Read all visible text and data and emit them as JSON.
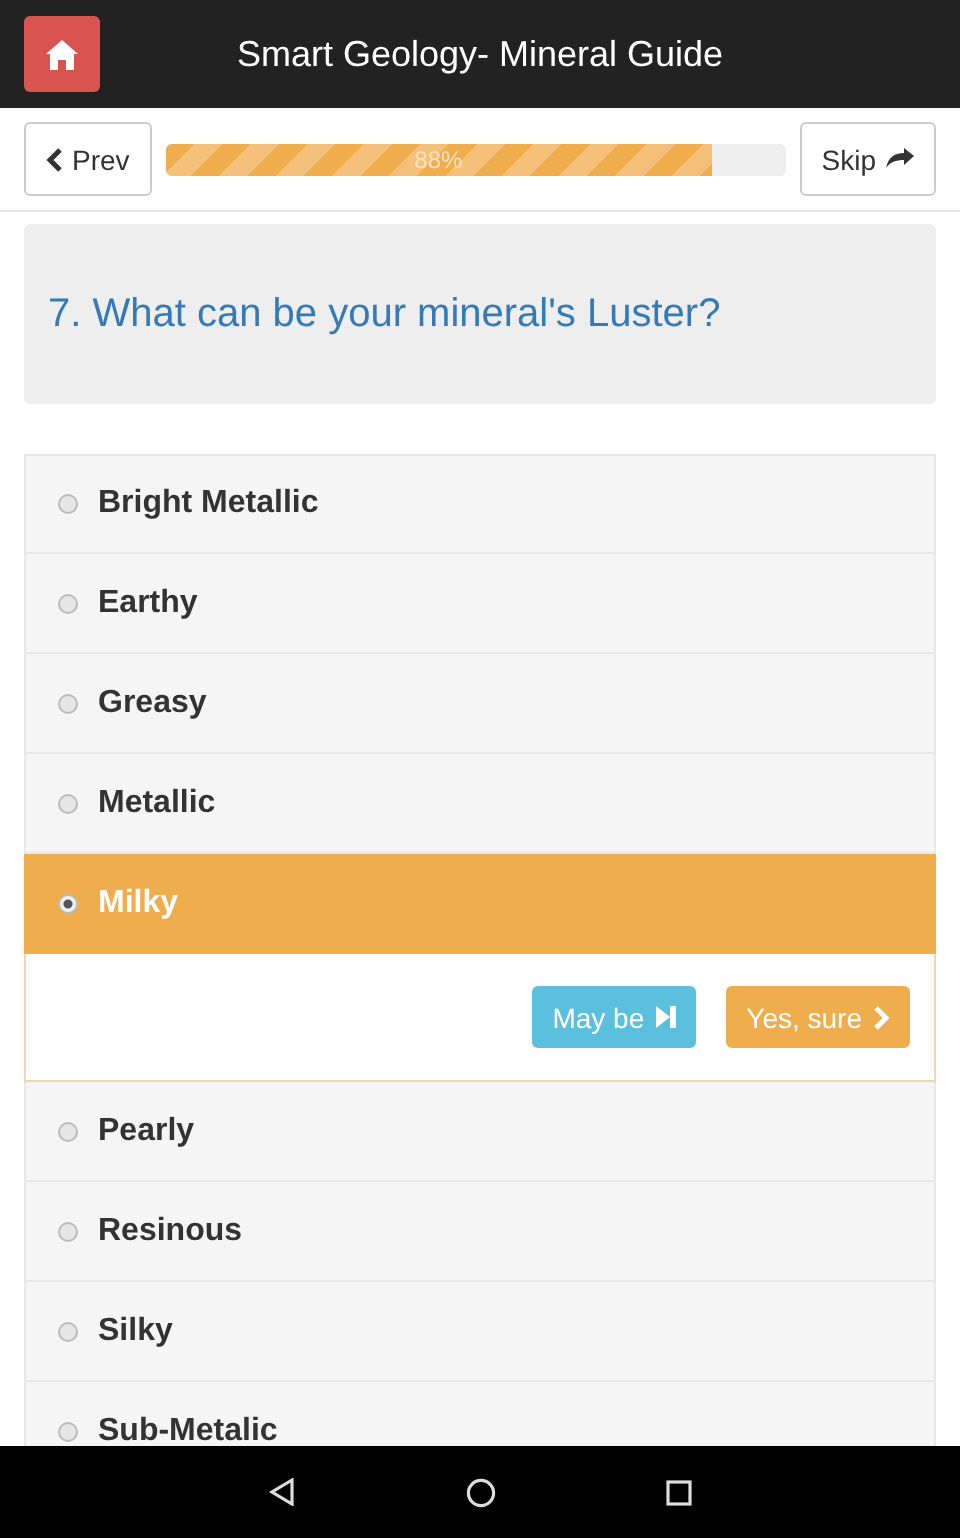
{
  "header": {
    "title": "Smart Geology- Mineral Guide"
  },
  "nav": {
    "prev": "Prev",
    "skip": "Skip",
    "progress": {
      "level": 0.88,
      "label": "88%"
    }
  },
  "question": "7. What can be your mineral's Luster?",
  "options": [
    {
      "label": "Bright Metallic",
      "selected": false
    },
    {
      "label": "Earthy",
      "selected": false
    },
    {
      "label": "Greasy",
      "selected": false
    },
    {
      "label": "Metallic",
      "selected": false
    },
    {
      "label": "Milky",
      "selected": true
    },
    {
      "label": "Pearly",
      "selected": false
    },
    {
      "label": "Resinous",
      "selected": false
    },
    {
      "label": "Silky",
      "selected": false
    },
    {
      "label": "Sub-Metalic",
      "selected": false
    }
  ],
  "answer_buttons": {
    "maybe": "May be",
    "yes": "Yes, sure"
  }
}
